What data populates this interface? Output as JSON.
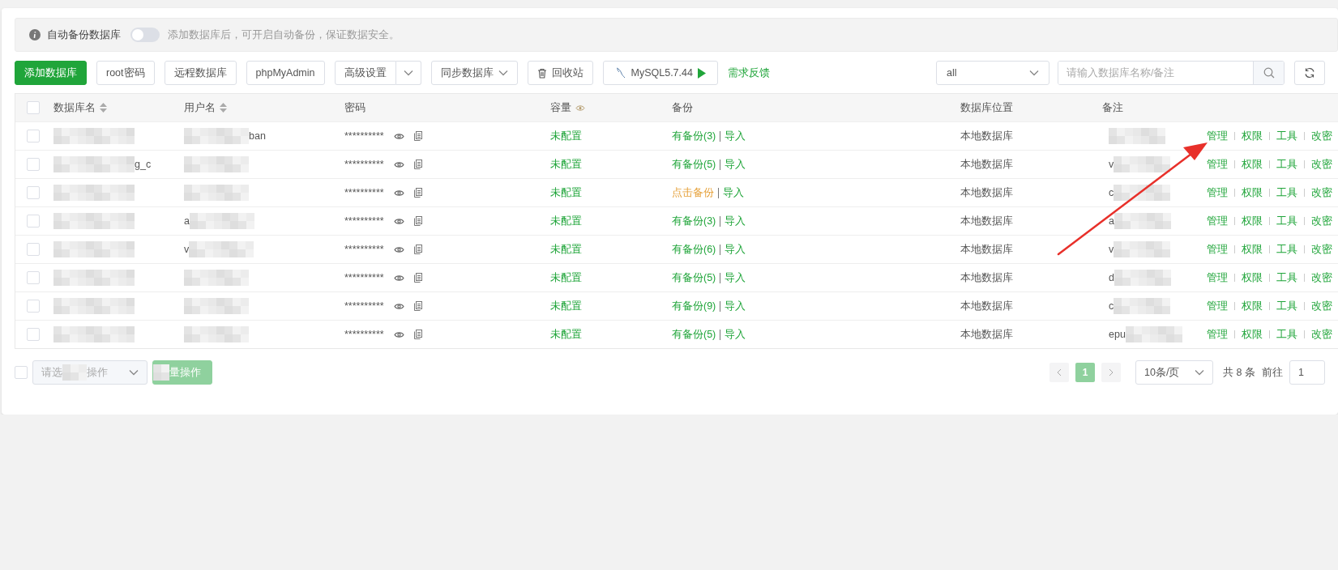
{
  "notice": {
    "label": "自动备份数据库",
    "toggle_on": false,
    "hint": "添加数据库后，可开启自动备份，保证数据安全。"
  },
  "toolbar": {
    "buttons": [
      {
        "kind": "primary",
        "label": "添加数据库"
      },
      {
        "kind": "plain",
        "label": "root密码"
      },
      {
        "kind": "plain",
        "label": "远程数据库"
      },
      {
        "kind": "plain",
        "label": "phpMyAdmin"
      },
      {
        "kind": "split",
        "label": "高级设置"
      },
      {
        "kind": "dropdown",
        "label": "同步数据库"
      },
      {
        "kind": "trash",
        "label": "回收站"
      },
      {
        "kind": "mysql",
        "label": "MySQL5.7.44"
      }
    ],
    "feedback_link": "需求反馈",
    "filter_select": "all",
    "search_placeholder": "请输入数据库名称/备注"
  },
  "table": {
    "all_checked": false,
    "columns": [
      {
        "label": "数据库名",
        "kind": "sortable"
      },
      {
        "label": "用户名",
        "kind": "sortable"
      },
      {
        "label": "密码",
        "kind": "plain"
      },
      {
        "label": "容量",
        "kind": "eye"
      },
      {
        "label": "备份",
        "kind": "plain"
      },
      {
        "label": "数据库位置",
        "kind": "plain"
      },
      {
        "label": "备注",
        "kind": "plain"
      }
    ],
    "rows": [
      {
        "checked": false,
        "name": {
          "redacted": true
        },
        "user": {
          "redacted": true,
          "suffix": "ban"
        },
        "password": "**********",
        "capacity": "未配置",
        "backup": {
          "kind": "has",
          "label": "有备份(3)"
        },
        "import": "导入",
        "location": "本地数据库",
        "remark": {
          "redacted": true
        },
        "actions": [
          "管理",
          "权限",
          "工具",
          "改密"
        ]
      },
      {
        "checked": false,
        "name": {
          "redacted": true,
          "suffix": "g_c"
        },
        "user": {
          "redacted": true
        },
        "password": "**********",
        "capacity": "未配置",
        "backup": {
          "kind": "has",
          "label": "有备份(5)"
        },
        "import": "导入",
        "location": "本地数据库",
        "remark": {
          "redacted": true,
          "prefix": "v"
        },
        "actions": [
          "管理",
          "权限",
          "工具",
          "改密"
        ]
      },
      {
        "checked": false,
        "name": {
          "redacted": true
        },
        "user": {
          "redacted": true
        },
        "password": "**********",
        "capacity": "未配置",
        "backup": {
          "kind": "none",
          "label": "点击备份"
        },
        "import": "导入",
        "location": "本地数据库",
        "remark": {
          "redacted": true,
          "prefix": "c"
        },
        "actions": [
          "管理",
          "权限",
          "工具",
          "改密"
        ]
      },
      {
        "checked": false,
        "name": {
          "redacted": true
        },
        "user": {
          "redacted": true,
          "prefix": "a"
        },
        "password": "**********",
        "capacity": "未配置",
        "backup": {
          "kind": "has",
          "label": "有备份(3)"
        },
        "import": "导入",
        "location": "本地数据库",
        "remark": {
          "redacted": true,
          "prefix": "a"
        },
        "actions": [
          "管理",
          "权限",
          "工具",
          "改密"
        ]
      },
      {
        "checked": false,
        "name": {
          "redacted": true
        },
        "user": {
          "redacted": true,
          "prefix": "v"
        },
        "password": "**********",
        "capacity": "未配置",
        "backup": {
          "kind": "has",
          "label": "有备份(6)"
        },
        "import": "导入",
        "location": "本地数据库",
        "remark": {
          "redacted": true,
          "prefix": "v"
        },
        "actions": [
          "管理",
          "权限",
          "工具",
          "改密"
        ]
      },
      {
        "checked": false,
        "name": {
          "redacted": true
        },
        "user": {
          "redacted": true
        },
        "password": "**********",
        "capacity": "未配置",
        "backup": {
          "kind": "has",
          "label": "有备份(5)"
        },
        "import": "导入",
        "location": "本地数据库",
        "remark": {
          "redacted": true,
          "prefix": "d"
        },
        "actions": [
          "管理",
          "权限",
          "工具",
          "改密"
        ]
      },
      {
        "checked": false,
        "name": {
          "redacted": true
        },
        "user": {
          "redacted": true
        },
        "password": "**********",
        "capacity": "未配置",
        "backup": {
          "kind": "has",
          "label": "有备份(9)"
        },
        "import": "导入",
        "location": "本地数据库",
        "remark": {
          "redacted": true,
          "prefix": "c"
        },
        "actions": [
          "管理",
          "权限",
          "工具",
          "改密"
        ]
      },
      {
        "checked": false,
        "name": {
          "redacted": true
        },
        "user": {
          "redacted": true
        },
        "password": "**********",
        "capacity": "未配置",
        "backup": {
          "kind": "has",
          "label": "有备份(5)"
        },
        "import": "导入",
        "location": "本地数据库",
        "remark": {
          "redacted": true,
          "prefix": "epu"
        },
        "actions": [
          "管理",
          "权限",
          "工具",
          "改密"
        ]
      }
    ]
  },
  "footer": {
    "checked": false,
    "batch_select": {
      "prefix": "请选",
      "suffix": "操作"
    },
    "batch_button": "量操作",
    "pager": {
      "pages": [
        {
          "label": "1",
          "selected": true
        }
      ],
      "page_size": "10条/页",
      "total": "共 8 条",
      "goto_label": "前往",
      "goto_value": "1"
    }
  }
}
